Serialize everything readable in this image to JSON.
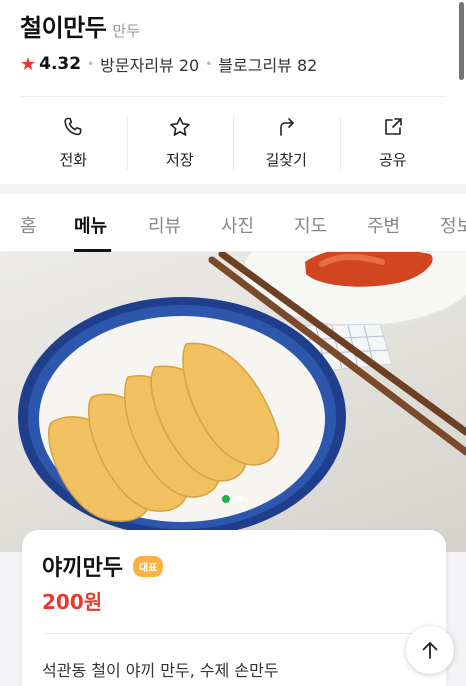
{
  "place": {
    "name": "철이만두",
    "category": "만두",
    "rating": "4.32",
    "visitor_reviews": "방문자리뷰 20",
    "blog_reviews": "블로그리뷰 82"
  },
  "actions": [
    {
      "label": "전화",
      "icon": "phone-icon"
    },
    {
      "label": "저장",
      "icon": "star-icon"
    },
    {
      "label": "길찾기",
      "icon": "directions-icon"
    },
    {
      "label": "공유",
      "icon": "share-icon"
    }
  ],
  "tabs": [
    {
      "label": "홈",
      "active": false
    },
    {
      "label": "메뉴",
      "active": true
    },
    {
      "label": "리뷰",
      "active": false
    },
    {
      "label": "사진",
      "active": false
    },
    {
      "label": "지도",
      "active": false
    },
    {
      "label": "주변",
      "active": false
    },
    {
      "label": "정보",
      "active": false
    }
  ],
  "hero": {
    "pager_active": 1,
    "pager_count": 2
  },
  "menu_item": {
    "name": "야끼만두",
    "badge": "대표",
    "price": "200원",
    "description": "석관동 철이 야끼 만두, 수제 손만두"
  },
  "colors": {
    "accent_red": "#e8382f",
    "badge_orange": "#ffb23f",
    "pager_green": "#19b04b"
  }
}
